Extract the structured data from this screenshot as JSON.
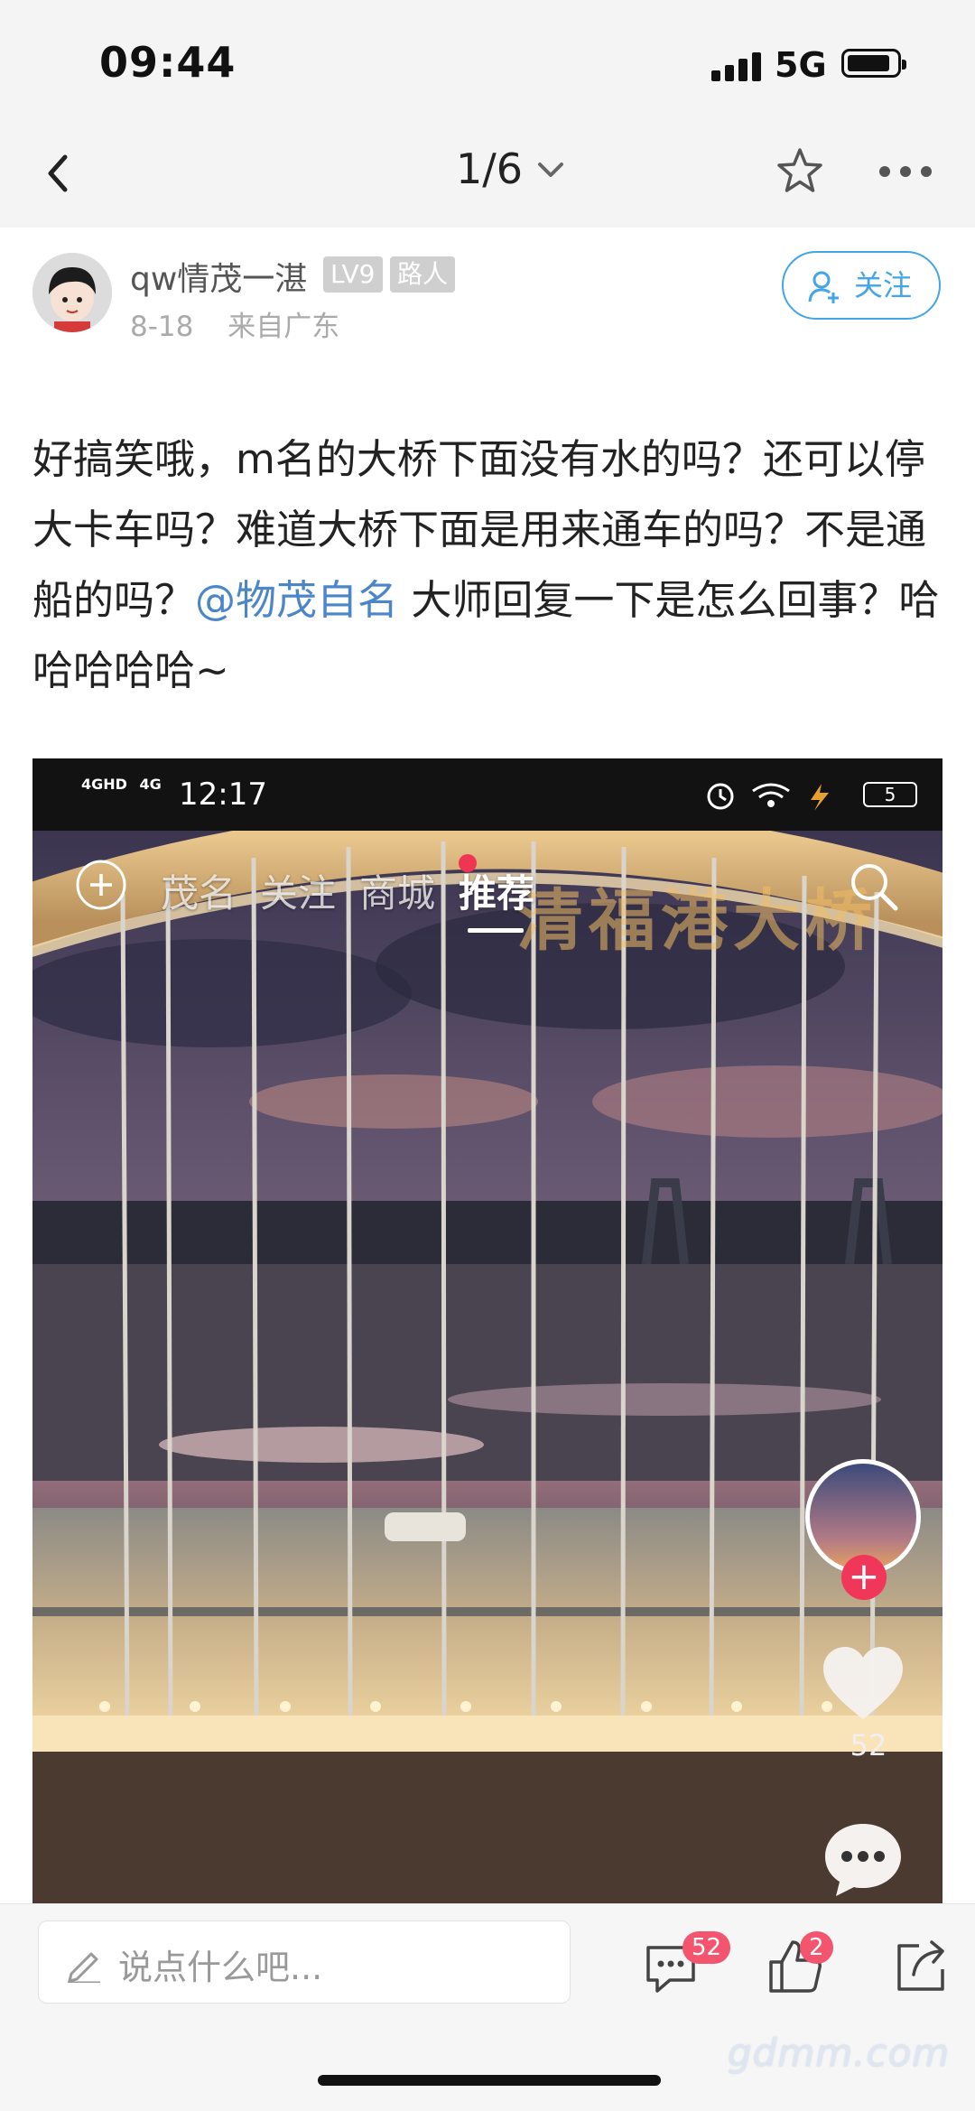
{
  "status_bar": {
    "time": "09:44",
    "network": "5G"
  },
  "nav": {
    "pager": "1/6"
  },
  "author": {
    "name": "qw情茂一湛",
    "level": "LV9",
    "role": "路人",
    "date": "8-18",
    "location": "来自广东",
    "follow_label": "关注"
  },
  "post": {
    "text_before": "好搞笑哦，m名的大桥下面没有水的吗？还可以停大卡车吗？难道大桥下面是用来通车的吗？不是通船的吗？",
    "mention": "@物茂自名",
    "text_after": " 大师回复一下是怎么回事？哈哈哈哈哈~"
  },
  "embedded": {
    "status_time": "12:17",
    "network_a": "4GHD",
    "network_b": "4G",
    "battery": "5",
    "tabs": [
      "茂名",
      "关注",
      "商城",
      "推荐"
    ],
    "active_tab": "推荐",
    "overlay_title": "清福港大桥",
    "like_count": "52"
  },
  "bottom": {
    "comment_placeholder": "说点什么吧...",
    "comment_badge": "52",
    "like_badge": "2",
    "watermark": "gdmm.com"
  },
  "colors": {
    "accent": "#43a5e8",
    "mention": "#4a86c8",
    "badge": "#f3556f"
  },
  "icons": [
    "back-icon",
    "chevron-down-icon",
    "star-icon",
    "more-icon",
    "add-user-icon",
    "pencil-icon",
    "comment-icon",
    "thumbs-up-icon",
    "share-icon",
    "search-icon",
    "heart-icon",
    "plus-icon"
  ]
}
